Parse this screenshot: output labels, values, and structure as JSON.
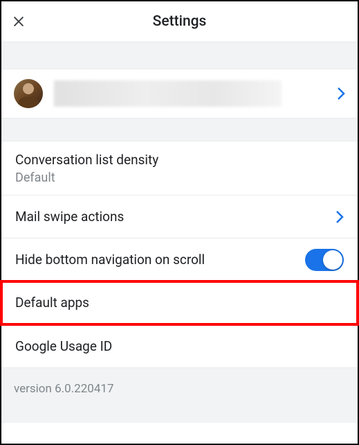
{
  "header": {
    "title": "Settings"
  },
  "account": {
    "name_redacted": true
  },
  "settings": {
    "conversation_density": {
      "label": "Conversation list density",
      "value": "Default"
    },
    "mail_swipe": {
      "label": "Mail swipe actions"
    },
    "hide_bottom_nav": {
      "label": "Hide bottom navigation on scroll",
      "toggled": true
    },
    "default_apps": {
      "label": "Default apps"
    },
    "google_usage_id": {
      "label": "Google Usage ID"
    }
  },
  "footer": {
    "version": "version 6.0.220417"
  }
}
